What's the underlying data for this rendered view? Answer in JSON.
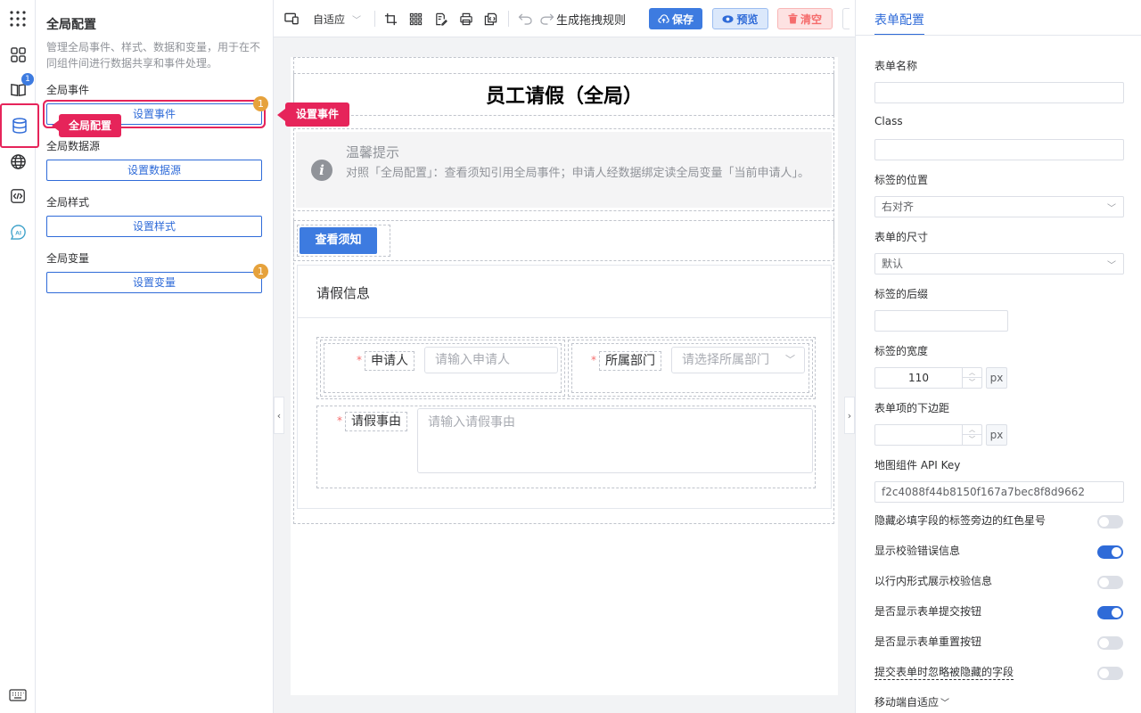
{
  "rail": {
    "badge_count": "1",
    "tooltip": "全局配置"
  },
  "global_panel": {
    "title": "全局配置",
    "description": "管理全局事件、样式、数据和变量，用于在不同组件间进行数据共享和事件处理。",
    "sections": [
      {
        "label": "全局事件",
        "button": "设置事件",
        "badge": "1"
      },
      {
        "label": "全局数据源",
        "button": "设置数据源"
      },
      {
        "label": "全局样式",
        "button": "设置样式"
      },
      {
        "label": "全局变量",
        "button": "设置变量",
        "badge": "1"
      }
    ],
    "event_tooltip": "设置事件"
  },
  "toolbar": {
    "layout_select": "自适应",
    "generate_rules": "生成拖拽规则",
    "save": "保存",
    "preview": "预览",
    "clear": "清空",
    "colors": {
      "save_bg": "#3d7be0",
      "preview_bg": "#dbe8fb",
      "clear_bg": "#fde2e2"
    }
  },
  "form": {
    "title": "员工请假（全局）",
    "alert_title": "温馨提示",
    "alert_text": "对照「全局配置」：查看须知引用全局事件；申请人经数据绑定读全局变量「当前申请人」。",
    "notice_button": "查看须知",
    "card_title": "请假信息",
    "fields": [
      {
        "label": "申请人",
        "placeholder": "请输入申请人",
        "required_mark": "*"
      },
      {
        "label": "所属部门",
        "placeholder": "请选择所属部门",
        "required_mark": "*"
      },
      {
        "label": "请假事由",
        "placeholder": "请输入请假事由",
        "required_mark": "*"
      }
    ]
  },
  "right_panel": {
    "tab": "表单配置",
    "form_name_label": "表单名称",
    "form_name_value": "",
    "class_label": "Class",
    "class_value": "",
    "label_position_label": "标签的位置",
    "label_position_value": "右对齐",
    "form_size_label": "表单的尺寸",
    "form_size_value": "默认",
    "label_suffix_label": "标签的后缀",
    "label_suffix_value": "",
    "label_width_label": "标签的宽度",
    "label_width_value": "110",
    "unit": "px",
    "item_margin_label": "表单项的下边距",
    "item_margin_value": "",
    "map_key_label": "地图组件 API Key",
    "map_key_value": "f2c4088f44b8150f167a7bec8f8d9662",
    "toggles": [
      {
        "label": "隐藏必填字段的标签旁边的红色星号",
        "on": false
      },
      {
        "label": "显示校验错误信息",
        "on": true
      },
      {
        "label": "以行内形式展示校验信息",
        "on": false
      },
      {
        "label": "是否显示表单提交按钮",
        "on": true
      },
      {
        "label": "是否显示表单重置按钮",
        "on": false
      },
      {
        "label": "提交表单时忽略被隐藏的字段",
        "on": false
      }
    ],
    "mobile_label": "移动端自适应"
  }
}
